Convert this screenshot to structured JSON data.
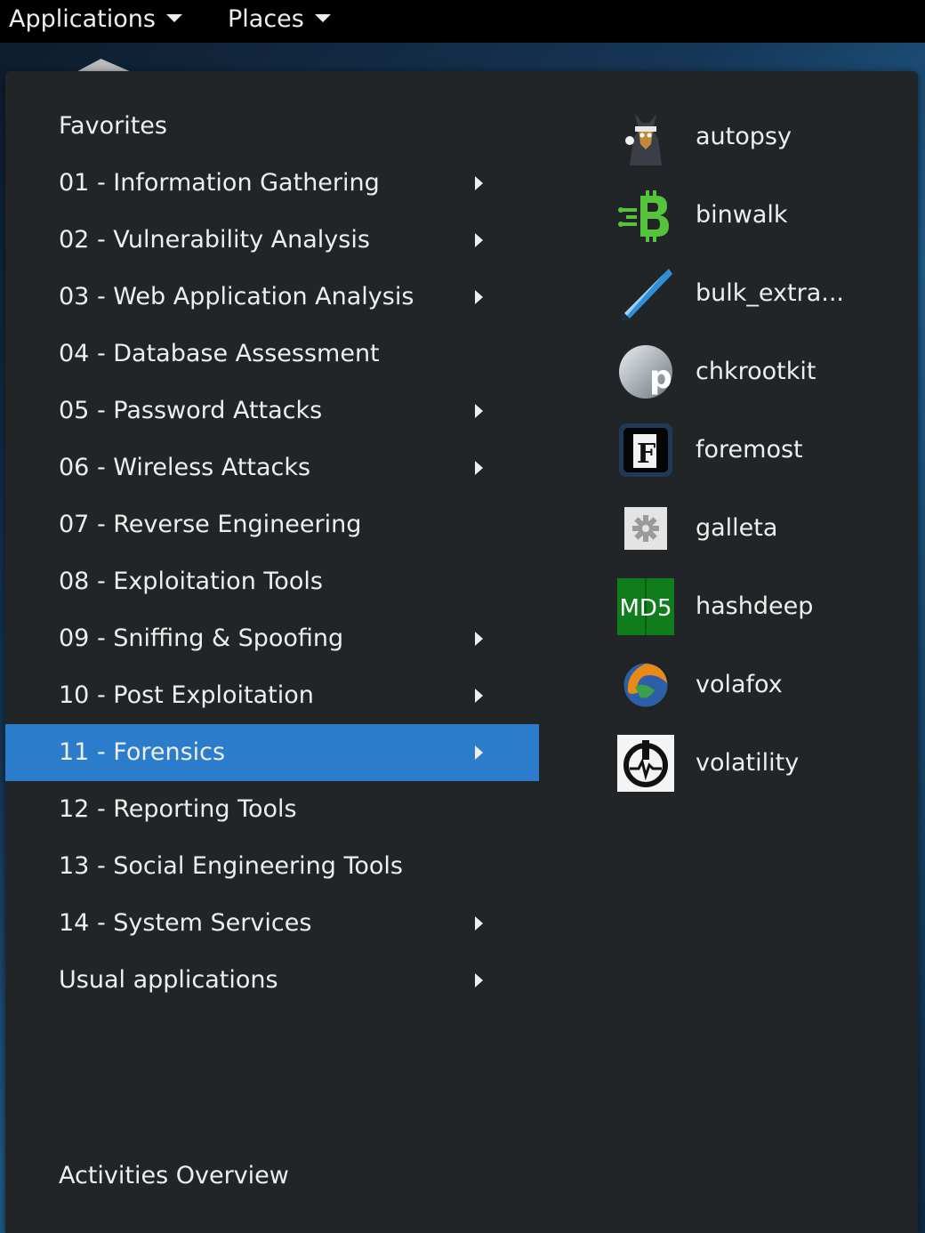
{
  "topbar": {
    "applications_label": "Applications",
    "places_label": "Places"
  },
  "categories": [
    {
      "label": "Favorites",
      "submenu": false
    },
    {
      "label": "01 - Information Gathering",
      "submenu": true
    },
    {
      "label": "02 - Vulnerability Analysis",
      "submenu": true
    },
    {
      "label": "03 - Web Application Analysis",
      "submenu": true
    },
    {
      "label": "04 - Database Assessment",
      "submenu": false
    },
    {
      "label": "05 - Password Attacks",
      "submenu": true
    },
    {
      "label": "06 - Wireless Attacks",
      "submenu": true
    },
    {
      "label": "07 - Reverse Engineering",
      "submenu": false
    },
    {
      "label": "08 - Exploitation Tools",
      "submenu": false
    },
    {
      "label": "09 - Sniffing & Spoofing",
      "submenu": true
    },
    {
      "label": "10 - Post Exploitation",
      "submenu": true
    },
    {
      "label": "11 - Forensics",
      "submenu": true,
      "selected": true
    },
    {
      "label": "12 - Reporting Tools",
      "submenu": false
    },
    {
      "label": "13 - Social Engineering Tools",
      "submenu": false
    },
    {
      "label": "14 - System Services",
      "submenu": true
    },
    {
      "label": "Usual applications",
      "submenu": true
    }
  ],
  "activities_label": "Activities Overview",
  "apps": [
    {
      "name": "autopsy",
      "icon": "autopsy-icon"
    },
    {
      "name": "binwalk",
      "icon": "binwalk-icon"
    },
    {
      "name": "bulk_extra...",
      "icon": "bulk-extractor-icon"
    },
    {
      "name": "chkrootkit",
      "icon": "chkrootkit-icon"
    },
    {
      "name": "foremost",
      "icon": "foremost-icon"
    },
    {
      "name": "galleta",
      "icon": "galleta-icon"
    },
    {
      "name": "hashdeep",
      "icon": "hashdeep-icon"
    },
    {
      "name": "volafox",
      "icon": "volafox-icon"
    },
    {
      "name": "volatility",
      "icon": "volatility-icon"
    }
  ],
  "icon_text": {
    "chkrootkit": "p",
    "foremost": "F",
    "hashdeep": "MD5"
  },
  "colors": {
    "selection": "#2b7cca",
    "menu_bg": "#222528",
    "topbar_bg": "#000000"
  }
}
